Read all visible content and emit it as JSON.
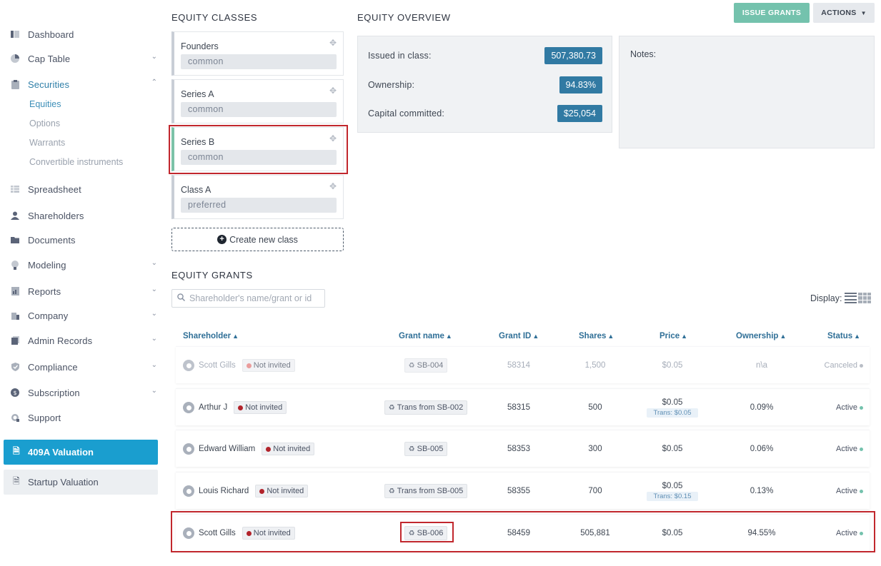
{
  "sidebar": {
    "items": [
      {
        "label": "Dashboard",
        "icon": "dashboard-icon"
      },
      {
        "label": "Cap Table",
        "icon": "pie-chart-icon"
      },
      {
        "label": "Securities",
        "icon": "clipboard-icon"
      },
      {
        "label": "Spreadsheet",
        "icon": "spreadsheet-icon"
      },
      {
        "label": "Shareholders",
        "icon": "user-icon"
      },
      {
        "label": "Documents",
        "icon": "folder-icon"
      },
      {
        "label": "Modeling",
        "icon": "lightbulb-icon"
      },
      {
        "label": "Reports",
        "icon": "report-icon"
      },
      {
        "label": "Company",
        "icon": "building-icon"
      },
      {
        "label": "Admin Records",
        "icon": "records-icon"
      },
      {
        "label": "Compliance",
        "icon": "shield-check-icon"
      },
      {
        "label": "Subscription",
        "icon": "dollar-icon"
      },
      {
        "label": "Support",
        "icon": "support-icon"
      }
    ],
    "securities_sub": [
      "Equities",
      "Options",
      "Warrants",
      "Convertible instruments"
    ],
    "btn_409a": "409A Valuation",
    "btn_startup": "Startup Valuation"
  },
  "equity_classes": {
    "title": "EQUITY CLASSES",
    "classes": [
      {
        "name": "Founders",
        "type": "common"
      },
      {
        "name": "Series A",
        "type": "common"
      },
      {
        "name": "Series B",
        "type": "common"
      },
      {
        "name": "Class A",
        "type": "preferred"
      }
    ],
    "create_label": "Create new class"
  },
  "overview": {
    "title": "EQUITY OVERVIEW",
    "issued_label": "Issued in class:",
    "issued_value": "507,380.73",
    "ownership_label": "Ownership:",
    "ownership_value": "94.83%",
    "capital_label": "Capital committed:",
    "capital_value": "$25,054",
    "notes_label": "Notes:"
  },
  "toolbar": {
    "issue_label": "ISSUE GRANTS",
    "actions_label": "ACTIONS"
  },
  "grants": {
    "title": "EQUITY GRANTS",
    "search_placeholder": "Shareholder's name/grant or id",
    "display_label": "Display:",
    "columns": [
      "Shareholder",
      "Grant name",
      "Grant ID",
      "Shares",
      "Price",
      "Ownership",
      "Status"
    ],
    "rows": [
      {
        "name": "Scott Gills",
        "invite": "Not invited",
        "grant": "SB-004",
        "id": "58314",
        "shares": "1,500",
        "price": "$0.05",
        "trans": "",
        "ownership": "n\\a",
        "status": "Canceled"
      },
      {
        "name": "Arthur J",
        "invite": "Not invited",
        "grant": "Trans from SB-002",
        "id": "58315",
        "shares": "500",
        "price": "$0.05",
        "trans": "Trans: $0.05",
        "ownership": "0.09%",
        "status": "Active"
      },
      {
        "name": "Edward William",
        "invite": "Not invited",
        "grant": "SB-005",
        "id": "58353",
        "shares": "300",
        "price": "$0.05",
        "trans": "",
        "ownership": "0.06%",
        "status": "Active"
      },
      {
        "name": "Louis Richard",
        "invite": "Not invited",
        "grant": "Trans from SB-005",
        "id": "58355",
        "shares": "700",
        "price": "$0.05",
        "trans": "Trans: $0.15",
        "ownership": "0.13%",
        "status": "Active"
      },
      {
        "name": "Scott Gills",
        "invite": "Not invited",
        "grant": "SB-006",
        "id": "58459",
        "shares": "505,881",
        "price": "$0.05",
        "trans": "",
        "ownership": "94.55%",
        "status": "Active"
      }
    ]
  },
  "colors": {
    "accent_blue": "#1a9ecf",
    "value_badge": "#317aa3",
    "issue_green": "#74c2ad",
    "highlight_red": "#c1272d"
  }
}
